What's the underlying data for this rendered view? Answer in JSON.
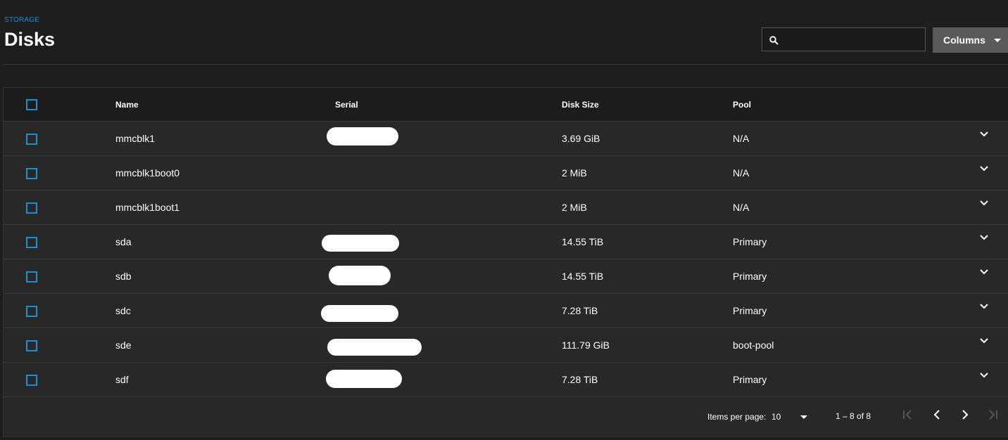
{
  "header": {
    "breadcrumb": "STORAGE",
    "title": "Disks"
  },
  "search": {
    "value": "",
    "icon": "search-icon"
  },
  "columns_button": {
    "label": "Columns",
    "icon": "caret-down-icon"
  },
  "table": {
    "headers": {
      "name": "Name",
      "serial": "Serial",
      "disk_size": "Disk Size",
      "pool": "Pool"
    },
    "rows": [
      {
        "name": "mmcblk1",
        "serial": "",
        "disk_size": "3.69 GiB",
        "pool": "N/A"
      },
      {
        "name": "mmcblk1boot0",
        "serial": "",
        "disk_size": "2 MiB",
        "pool": "N/A"
      },
      {
        "name": "mmcblk1boot1",
        "serial": "",
        "disk_size": "2 MiB",
        "pool": "N/A"
      },
      {
        "name": "sda",
        "serial": "",
        "disk_size": "14.55 TiB",
        "pool": "Primary"
      },
      {
        "name": "sdb",
        "serial": "",
        "disk_size": "14.55 TiB",
        "pool": "Primary"
      },
      {
        "name": "sdc",
        "serial": "",
        "disk_size": "7.28 TiB",
        "pool": "Primary"
      },
      {
        "name": "sde",
        "serial": "",
        "disk_size": "111.79 GiB",
        "pool": "boot-pool"
      },
      {
        "name": "sdf",
        "serial": "",
        "disk_size": "7.28 TiB",
        "pool": "Primary"
      }
    ]
  },
  "paginator": {
    "items_per_page_label": "Items per page:",
    "page_size": "10",
    "range": "1 – 8 of 8"
  },
  "colors": {
    "accent": "#1a8fd1",
    "background": "#1e1e1e",
    "card": "#282828",
    "button": "#5a5a5a"
  }
}
